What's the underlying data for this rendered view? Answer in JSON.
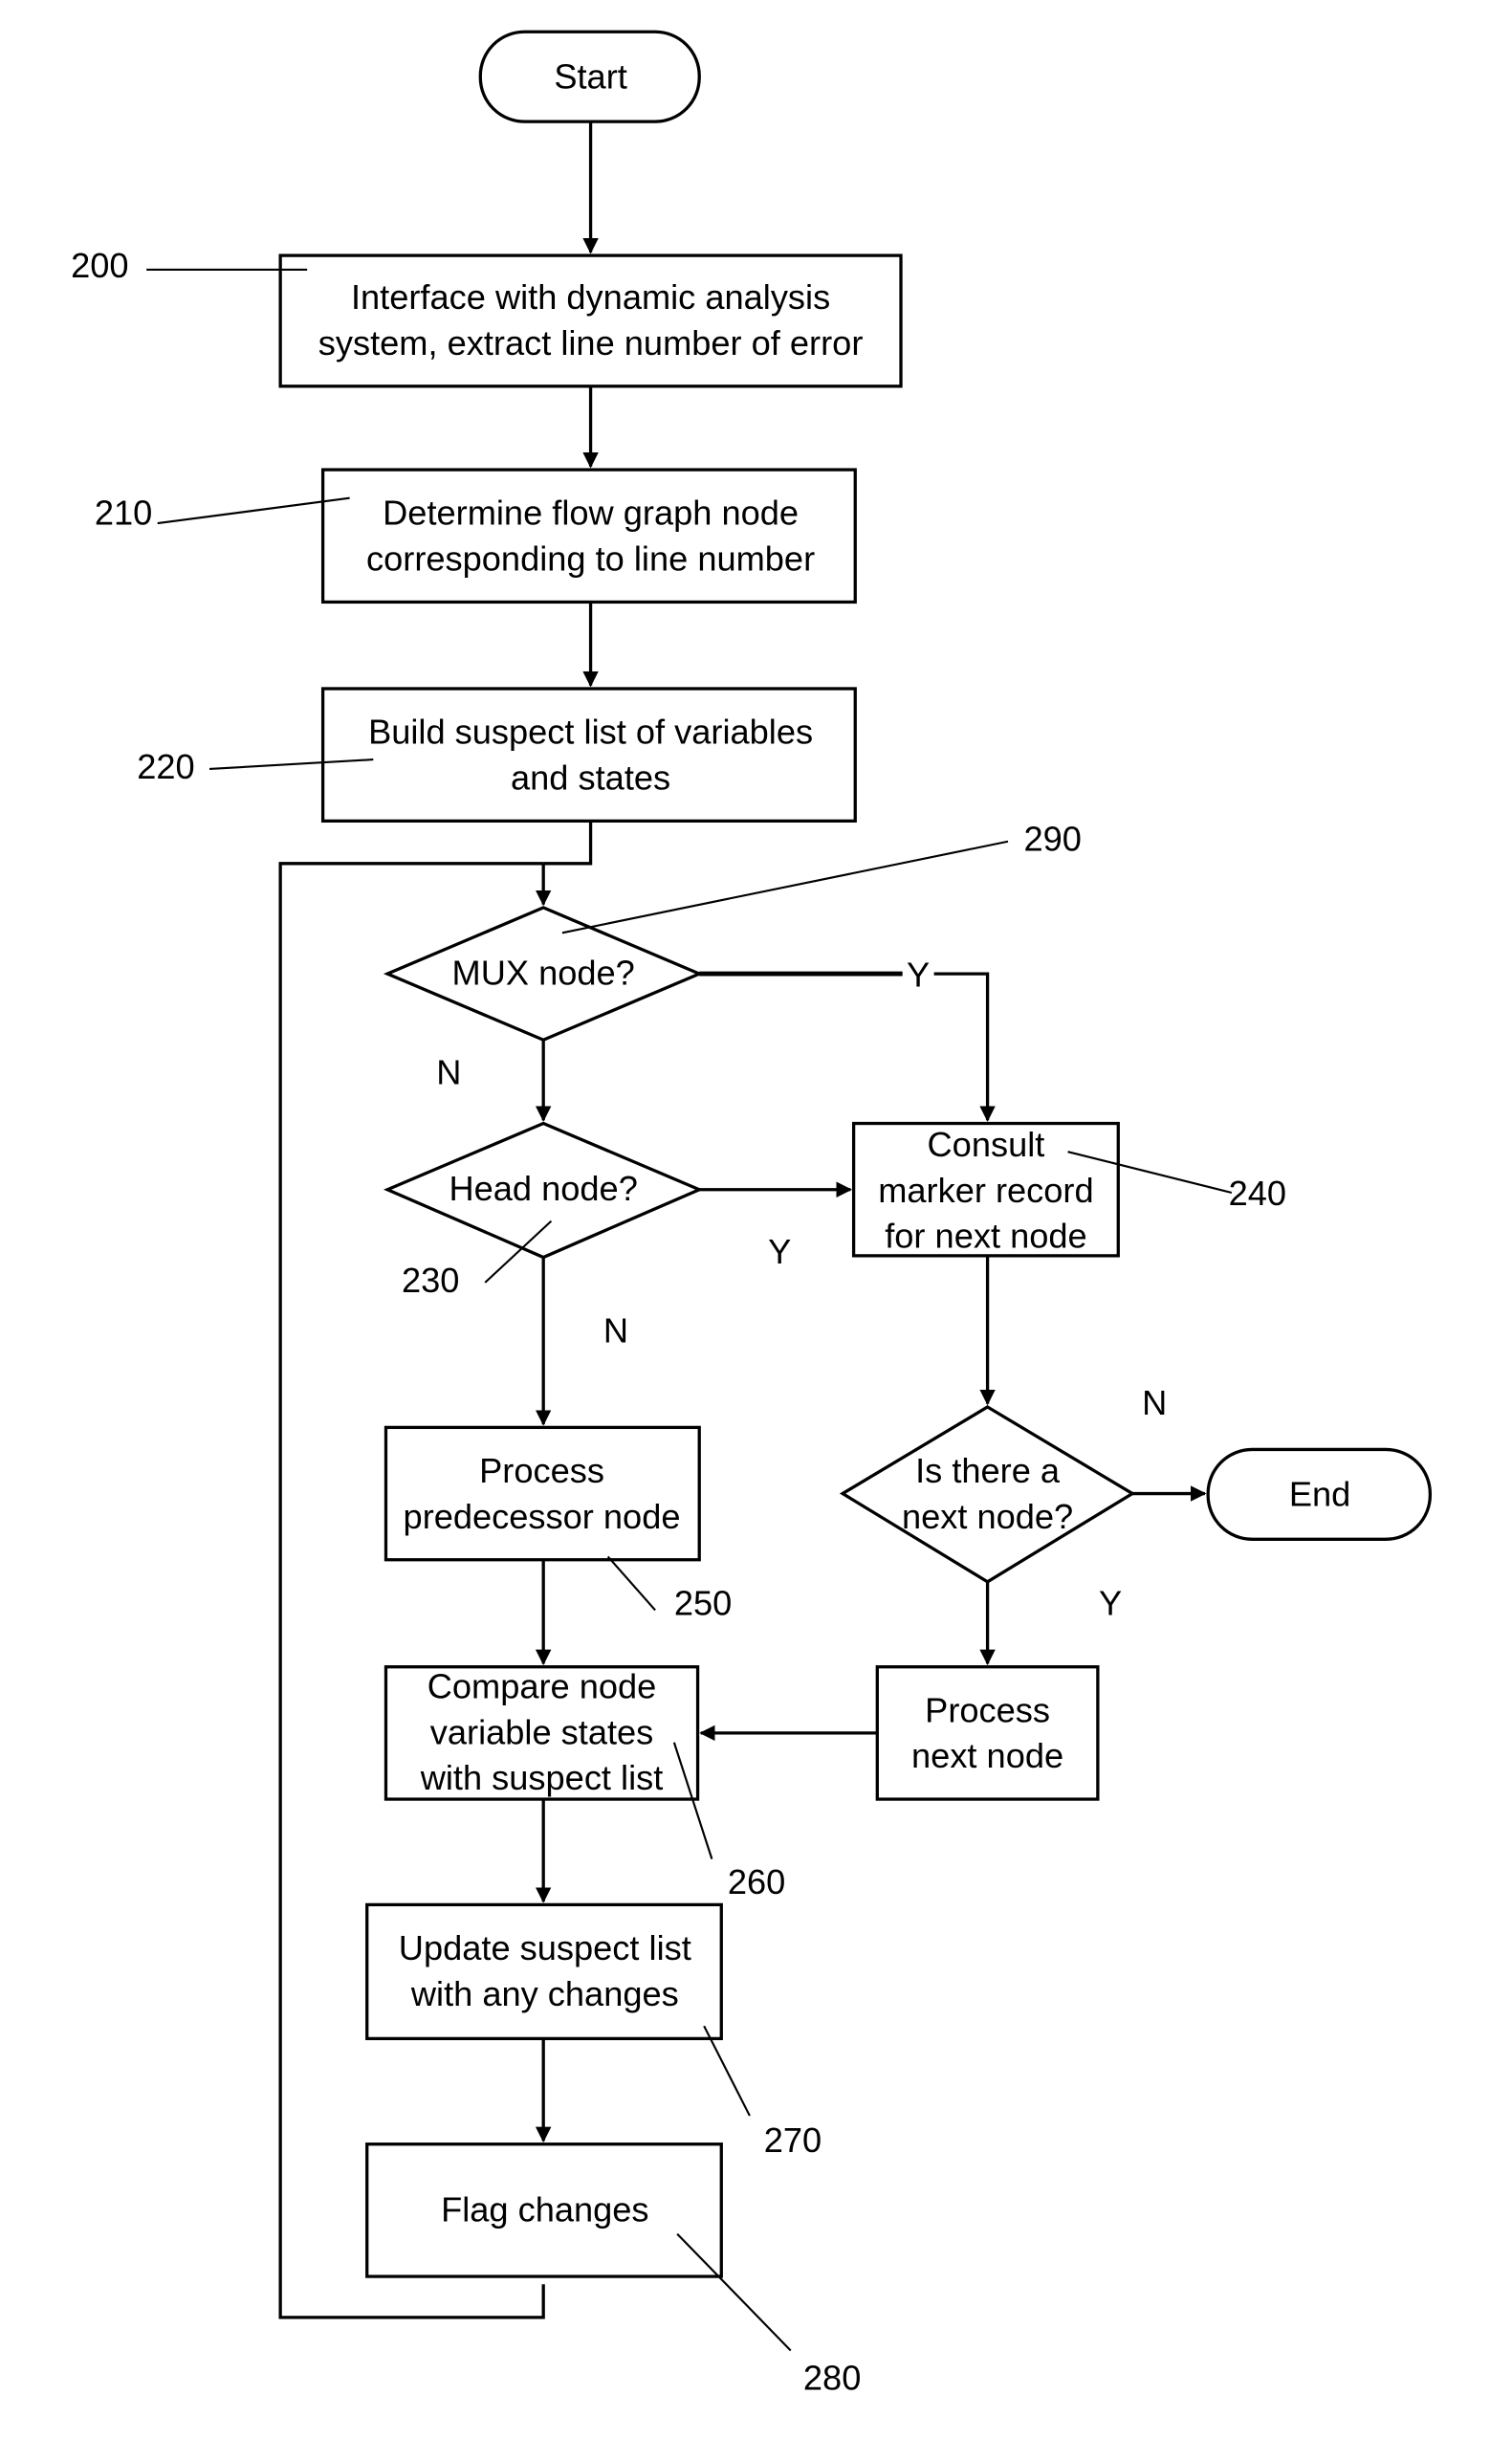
{
  "diagram": {
    "type": "flowchart",
    "terminals": {
      "start": "Start",
      "end": "End"
    },
    "steps": {
      "s200": [
        "Interface with dynamic analysis",
        "system, extract line number of error"
      ],
      "s210": [
        "Determine flow graph node",
        "corresponding to line number"
      ],
      "s220": [
        "Build suspect list of variables",
        "and states"
      ],
      "s240": [
        "Consult",
        "marker record",
        "for next node"
      ],
      "s250": [
        "Process",
        "predecessor node"
      ],
      "s260": [
        "Compare node",
        "variable states",
        "with suspect list"
      ],
      "s270": [
        "Update suspect list",
        "with any changes"
      ],
      "s280": [
        "Flag changes"
      ],
      "process_next": [
        "Process",
        "next node"
      ]
    },
    "decisions": {
      "mux": "MUX node?",
      "head": "Head node?",
      "next": [
        "Is there a",
        "next node?"
      ]
    },
    "branch_labels": {
      "mux_yes": "Y",
      "mux_no": "N",
      "head_yes": "Y",
      "head_no": "N",
      "next_no": "N",
      "next_yes": "Y"
    },
    "reference_numerals": {
      "r200": "200",
      "r210": "210",
      "r220": "220",
      "r230": "230",
      "r240": "240",
      "r250": "250",
      "r260": "260",
      "r270": "270",
      "r280": "280",
      "r290": "290"
    }
  }
}
